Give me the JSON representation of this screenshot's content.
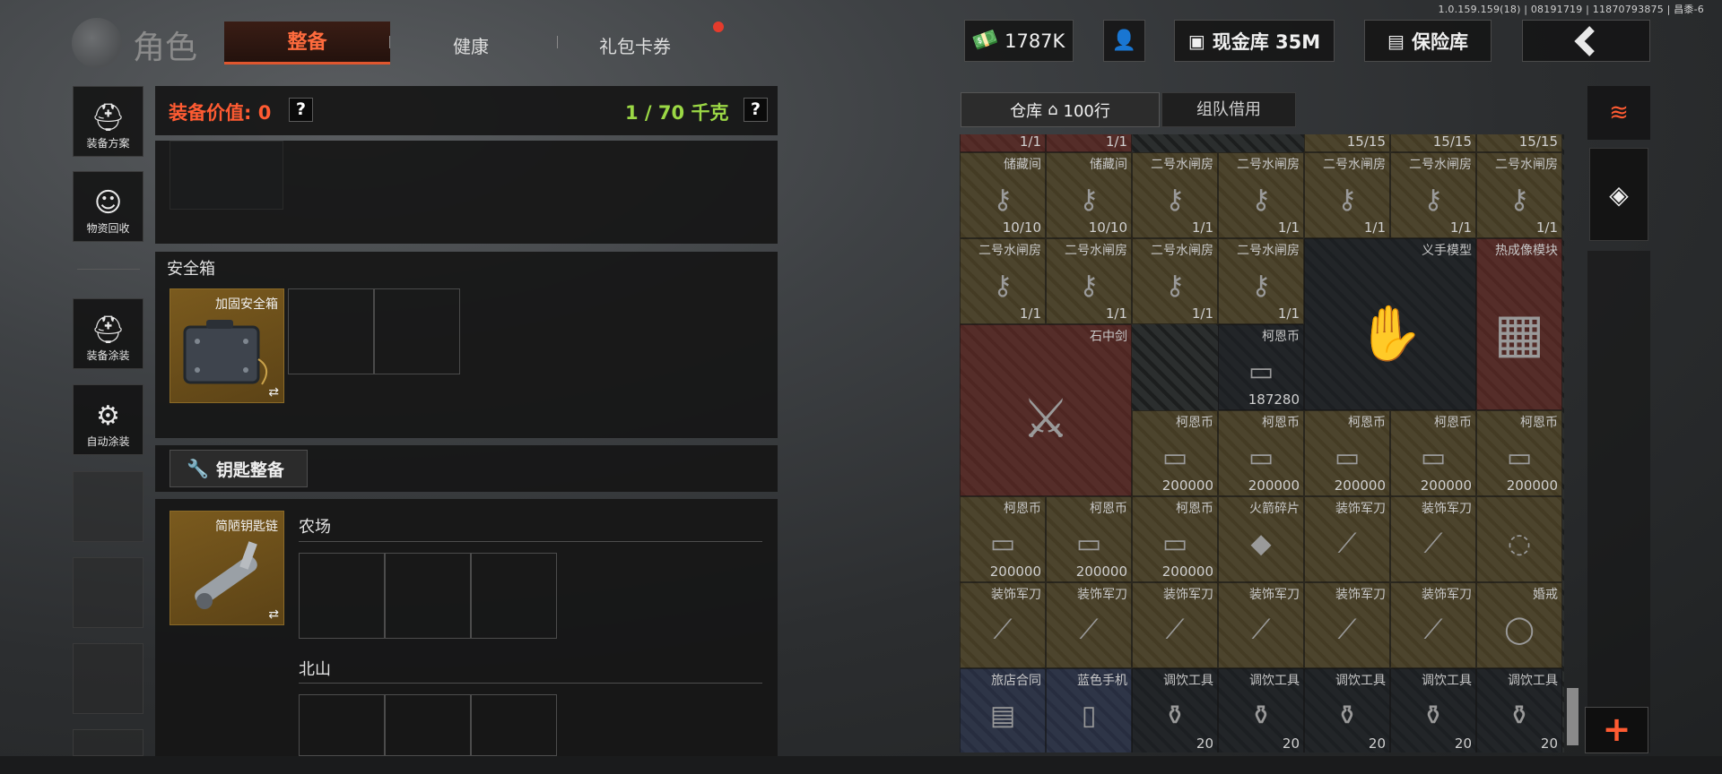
{
  "build_info": "1.0.159.159(18) | 08191719 | 11870793875 | 昌黍-6",
  "header": {
    "title": "角色",
    "tabs": [
      {
        "label": "整备",
        "active": true
      },
      {
        "label": "健康",
        "active": false
      },
      {
        "label": "礼包卡券",
        "active": false,
        "badge": "red-dot"
      }
    ],
    "money": "1787K",
    "cash_vault": "现金库 35M",
    "safe_vault": "保险库"
  },
  "sidebar": {
    "items": [
      {
        "label": "装备方案",
        "icon": "helmet-grid-icon"
      },
      {
        "label": "物资回收",
        "icon": "recycle-face-icon"
      },
      {
        "label": "装备涂装",
        "icon": "helmet-brush-icon"
      },
      {
        "label": "自动涂装",
        "icon": "brush-gear-icon"
      }
    ]
  },
  "loadout": {
    "value_label": "装备价值: 0",
    "weight_label": "1 / 70 千克",
    "help": "?",
    "safebox_title": "安全箱",
    "safebox_item": "加固安全箱",
    "swap": "⇄",
    "key_button": "钥匙整备",
    "keychain_item": "简陋钥匙链",
    "key_groups": [
      "农场",
      "北山"
    ]
  },
  "warehouse": {
    "tab_warehouse": "仓库",
    "tab_warehouse_rows": "100行",
    "tab_team": "组队借用",
    "cells": [
      {
        "name": "",
        "num": "1/1",
        "col": 0,
        "row": -1,
        "w": 1,
        "h": 1,
        "tone": "red"
      },
      {
        "name": "",
        "num": "1/1",
        "col": 1,
        "row": -1,
        "w": 1,
        "h": 1,
        "tone": "red"
      },
      {
        "name": "",
        "num": "15/15",
        "col": 4,
        "row": -1,
        "w": 1,
        "h": 1,
        "tone": "gold"
      },
      {
        "name": "",
        "num": "15/15",
        "col": 5,
        "row": -1,
        "w": 1,
        "h": 1,
        "tone": "gold"
      },
      {
        "name": "",
        "num": "15/15",
        "col": 6,
        "row": -1,
        "w": 1,
        "h": 1,
        "tone": "gold"
      },
      {
        "name": "储藏间",
        "num": "10/10",
        "col": 0,
        "row": 0,
        "w": 1,
        "h": 1,
        "tone": "gold"
      },
      {
        "name": "储藏间",
        "num": "10/10",
        "col": 1,
        "row": 0,
        "w": 1,
        "h": 1,
        "tone": "gold"
      },
      {
        "name": "二号水闸房",
        "num": "1/1",
        "col": 2,
        "row": 0,
        "w": 1,
        "h": 1,
        "tone": "gold"
      },
      {
        "name": "二号水闸房",
        "num": "1/1",
        "col": 3,
        "row": 0,
        "w": 1,
        "h": 1,
        "tone": "gold"
      },
      {
        "name": "二号水闸房",
        "num": "1/1",
        "col": 4,
        "row": 0,
        "w": 1,
        "h": 1,
        "tone": "gold"
      },
      {
        "name": "二号水闸房",
        "num": "1/1",
        "col": 5,
        "row": 0,
        "w": 1,
        "h": 1,
        "tone": "gold"
      },
      {
        "name": "二号水闸房",
        "num": "1/1",
        "col": 6,
        "row": 0,
        "w": 1,
        "h": 1,
        "tone": "gold"
      },
      {
        "name": "二号水闸房",
        "num": "1/1",
        "col": 0,
        "row": 1,
        "w": 1,
        "h": 1,
        "tone": "gold"
      },
      {
        "name": "二号水闸房",
        "num": "1/1",
        "col": 1,
        "row": 1,
        "w": 1,
        "h": 1,
        "tone": "gold"
      },
      {
        "name": "二号水闸房",
        "num": "1/1",
        "col": 2,
        "row": 1,
        "w": 1,
        "h": 1,
        "tone": "gold"
      },
      {
        "name": "二号水闸房",
        "num": "1/1",
        "col": 3,
        "row": 1,
        "w": 1,
        "h": 1,
        "tone": "gold"
      },
      {
        "name": "义手模型",
        "num": "",
        "col": 4,
        "row": 1,
        "w": 2,
        "h": 2,
        "tone": "dark"
      },
      {
        "name": "热成像模块",
        "num": "",
        "col": 6,
        "row": 1,
        "w": 1,
        "h": 2,
        "tone": "red"
      },
      {
        "name": "石中剑",
        "num": "",
        "col": 0,
        "row": 2,
        "w": 2,
        "h": 2,
        "tone": "red"
      },
      {
        "name": "柯恩币",
        "num": "187280",
        "col": 3,
        "row": 2,
        "w": 1,
        "h": 1,
        "tone": "dark"
      },
      {
        "name": "柯恩币",
        "num": "200000",
        "col": 2,
        "row": 3,
        "w": 1,
        "h": 1,
        "tone": "gold"
      },
      {
        "name": "柯恩币",
        "num": "200000",
        "col": 3,
        "row": 3,
        "w": 1,
        "h": 1,
        "tone": "gold"
      },
      {
        "name": "柯恩币",
        "num": "200000",
        "col": 4,
        "row": 3,
        "w": 1,
        "h": 1,
        "tone": "gold"
      },
      {
        "name": "柯恩币",
        "num": "200000",
        "col": 5,
        "row": 3,
        "w": 1,
        "h": 1,
        "tone": "gold"
      },
      {
        "name": "柯恩币",
        "num": "200000",
        "col": 6,
        "row": 3,
        "w": 1,
        "h": 1,
        "tone": "gold"
      },
      {
        "name": "柯恩币",
        "num": "200000",
        "col": 0,
        "row": 4,
        "w": 1,
        "h": 1,
        "tone": "gold"
      },
      {
        "name": "柯恩币",
        "num": "200000",
        "col": 1,
        "row": 4,
        "w": 1,
        "h": 1,
        "tone": "gold"
      },
      {
        "name": "柯恩币",
        "num": "200000",
        "col": 2,
        "row": 4,
        "w": 1,
        "h": 1,
        "tone": "gold"
      },
      {
        "name": "火箭碎片",
        "num": "",
        "col": 3,
        "row": 4,
        "w": 1,
        "h": 1,
        "tone": "gold"
      },
      {
        "name": "装饰军刀",
        "num": "",
        "col": 4,
        "row": 4,
        "w": 1,
        "h": 1,
        "tone": "gold"
      },
      {
        "name": "装饰军刀",
        "num": "",
        "col": 5,
        "row": 4,
        "w": 1,
        "h": 1,
        "tone": "gold"
      },
      {
        "name": "",
        "num": "",
        "col": 6,
        "row": 4,
        "w": 1,
        "h": 1,
        "tone": "gold"
      },
      {
        "name": "装饰军刀",
        "num": "",
        "col": 0,
        "row": 5,
        "w": 1,
        "h": 1,
        "tone": "gold"
      },
      {
        "name": "装饰军刀",
        "num": "",
        "col": 1,
        "row": 5,
        "w": 1,
        "h": 1,
        "tone": "gold"
      },
      {
        "name": "装饰军刀",
        "num": "",
        "col": 2,
        "row": 5,
        "w": 1,
        "h": 1,
        "tone": "gold"
      },
      {
        "name": "装饰军刀",
        "num": "",
        "col": 3,
        "row": 5,
        "w": 1,
        "h": 1,
        "tone": "gold"
      },
      {
        "name": "装饰军刀",
        "num": "",
        "col": 4,
        "row": 5,
        "w": 1,
        "h": 1,
        "tone": "gold"
      },
      {
        "name": "装饰军刀",
        "num": "",
        "col": 5,
        "row": 5,
        "w": 1,
        "h": 1,
        "tone": "gold"
      },
      {
        "name": "婚戒",
        "num": "",
        "col": 6,
        "row": 5,
        "w": 1,
        "h": 1,
        "tone": "gold"
      },
      {
        "name": "旅店合同",
        "num": "",
        "col": 0,
        "row": 6,
        "w": 1,
        "h": 1,
        "tone": "blue"
      },
      {
        "name": "蓝色手机",
        "num": "",
        "col": 1,
        "row": 6,
        "w": 1,
        "h": 1,
        "tone": "blue"
      },
      {
        "name": "调饮工具",
        "num": "20",
        "col": 2,
        "row": 6,
        "w": 1,
        "h": 1,
        "tone": "dark"
      },
      {
        "name": "调饮工具",
        "num": "20",
        "col": 3,
        "row": 6,
        "w": 1,
        "h": 1,
        "tone": "dark"
      },
      {
        "name": "调饮工具",
        "num": "20",
        "col": 4,
        "row": 6,
        "w": 1,
        "h": 1,
        "tone": "dark"
      },
      {
        "name": "调饮工具",
        "num": "20",
        "col": 5,
        "row": 6,
        "w": 1,
        "h": 1,
        "tone": "dark"
      },
      {
        "name": "调饮工具",
        "num": "20",
        "col": 6,
        "row": 6,
        "w": 1,
        "h": 1,
        "tone": "dark"
      }
    ]
  }
}
